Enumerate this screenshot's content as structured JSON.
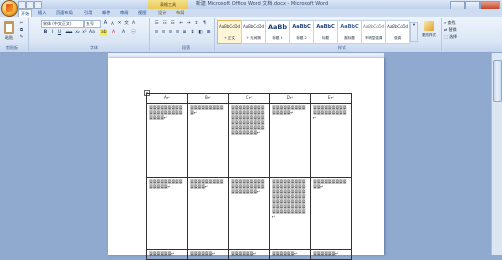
{
  "window": {
    "title": "新建 Microsoft Office Word 文档.docx - Microsoft Word",
    "context_tab": "表格工具"
  },
  "tabs": [
    "开始",
    "插入",
    "页面布局",
    "引用",
    "邮件",
    "审阅",
    "视图",
    "设计",
    "布局"
  ],
  "ribbon": {
    "clipboard": {
      "paste_label": "粘贴",
      "group_label": "剪贴板"
    },
    "font": {
      "font_name": "宋体 (中文正文)",
      "font_size": "五号",
      "bold": "B",
      "italic": "I",
      "underline": "U",
      "strike": "abe",
      "grow": "A",
      "shrink": "A",
      "group_label": "字体"
    },
    "paragraph": {
      "group_label": "段落"
    },
    "styles": {
      "group_label": "样式",
      "items": [
        {
          "sample": "AaBbCcDd",
          "name": "+ 正文"
        },
        {
          "sample": "AaBbCcDd",
          "name": "+ 无间隔"
        },
        {
          "sample": "AaBb",
          "name": "标题 1"
        },
        {
          "sample": "AaBbC",
          "name": "标题 2"
        },
        {
          "sample": "AaBbC",
          "name": "标题"
        },
        {
          "sample": "AaBbC",
          "name": "副标题"
        },
        {
          "sample": "AaBbCcDd",
          "name": "不明显强调"
        },
        {
          "sample": "AaBbCcDd",
          "name": "强调"
        }
      ],
      "change_styles": "更改样式"
    },
    "editing": {
      "find": "查找",
      "replace": "替换",
      "select": "选择"
    }
  },
  "table": {
    "headers": [
      "A↵",
      "B↵",
      "C↵",
      "D↵",
      "E↵"
    ],
    "rows": [
      [
        "臺臺臺臺臺臺臺臺臺臺臺臺臺臺臺臺臺臺臺臺臺臺↵",
        "臺臺臺臺臺臺臺臺臺臺↵",
        "臺臺臺臺臺臺臺臺臺臺臺臺臺臺臺臺臺臺臺臺臺臺臺臺臺臺臺臺臺臺臺臺臺臺臺臺臺臺臺臺臺臺臺臺臺臺臺臺臺臺臺臺↵",
        "臺臺臺臺臺臺臺臺臺臺臺臺臺臺↵",
        "臺臺臺臺臺臺臺臺臺臺臺臺臺臺臺臺臺臺↵"
      ],
      [
        "臺臺臺臺臺臺臺臺臺臺臺臺臺臺↵",
        "臺臺臺臺臺臺臺臺臺臺臺臺臺↵",
        "臺臺臺臺臺臺臺臺臺臺臺臺臺臺臺臺臺臺臺臺臺臺臺臺臺↵",
        "臺臺臺臺臺臺臺臺臺臺臺臺臺臺臺臺臺臺臺臺臺臺臺臺臺臺臺臺臺臺臺臺臺臺臺臺臺臺臺臺臺臺臺臺臺臺臺臺臺臺臺臺臺臺臺臺臺臺臺臺臺臺臺↵",
        "臺臺臺臺臺臺臺臺臺臺臺↵"
      ],
      [
        "臺臺臺臺臺臺↵",
        "臺臺臺臺臺臺↵",
        "臺臺臺臺臺臺↵",
        "臺臺臺臺臺臺↵",
        "臺臺臺臺臺臺↵"
      ]
    ]
  },
  "colors": {
    "ribbon_bg": "#dbe6f5",
    "workspace_bg": "#8fa9cf",
    "context_tab": "#e9c95a"
  }
}
